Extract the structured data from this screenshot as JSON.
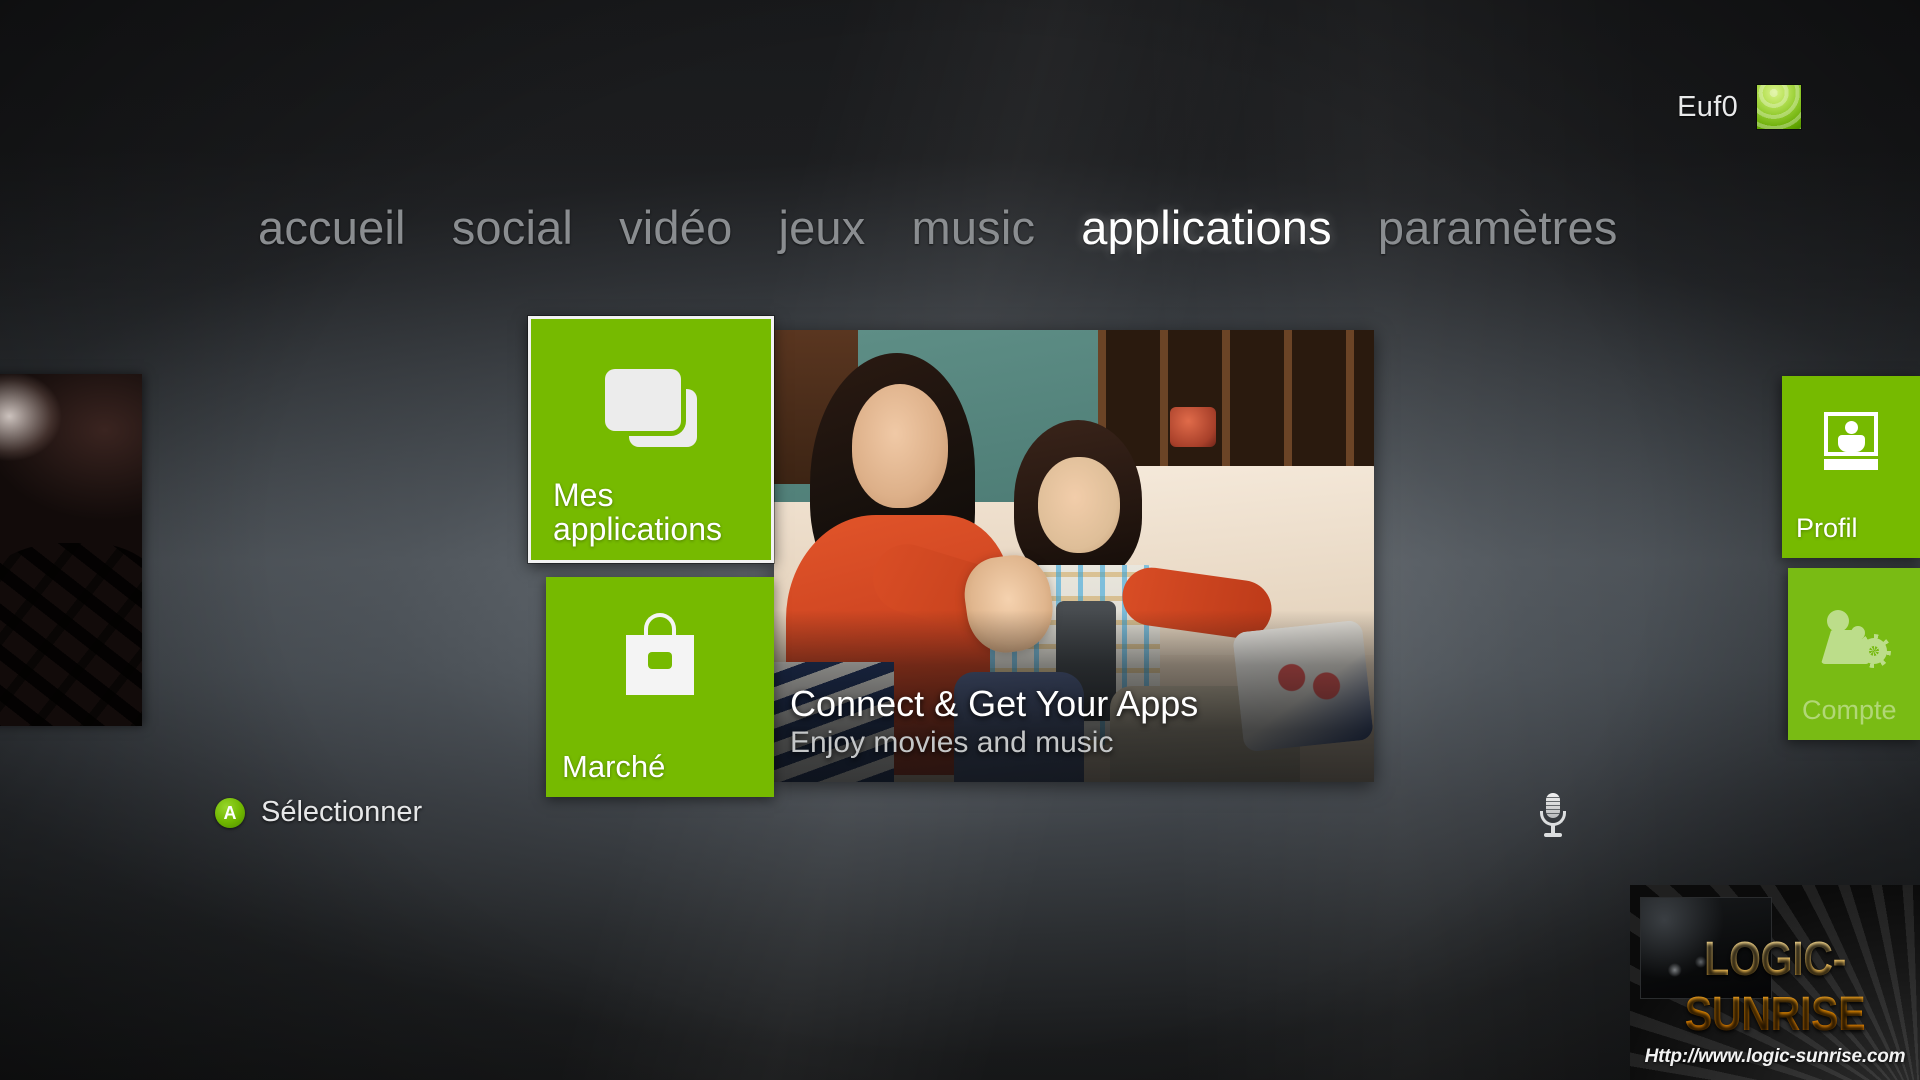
{
  "profile": {
    "gamertag": "Euf0",
    "gamerpic_name": "gamerpic"
  },
  "nav": {
    "items": [
      {
        "label": "accueil",
        "active": false
      },
      {
        "label": "social",
        "active": false
      },
      {
        "label": "vidéo",
        "active": false
      },
      {
        "label": "jeux",
        "active": false
      },
      {
        "label": "music",
        "active": false
      },
      {
        "label": "applications",
        "active": true
      },
      {
        "label": "paramètres",
        "active": false
      }
    ],
    "active_label": "applications"
  },
  "tiles": {
    "my_apps": {
      "label": "Mes\napplications",
      "label_line1": "Mes",
      "label_line2": "applications",
      "icon": "stacked-cards-icon",
      "selected": true
    },
    "marketplace": {
      "label": "Marché",
      "icon": "shopping-bag-icon",
      "selected": false
    }
  },
  "banner": {
    "title": "Connect & Get Your Apps",
    "subtitle": "Enjoy movies and music",
    "image_name": "family-watching-tv-photo"
  },
  "rail": {
    "profile_tile": {
      "label": "Profil",
      "icon": "profile-portrait-icon",
      "dimmed": false
    },
    "account_tile": {
      "label": "Compte",
      "icon": "family-settings-icon",
      "dimmed": true
    }
  },
  "peek": {
    "image_name": "previous-panel-photo"
  },
  "footer": {
    "button_glyph": "A",
    "action_label": "Sélectionner",
    "mic_icon": "microphone-icon"
  },
  "watermark": {
    "logo_text": "LOGIC-SUNRISE",
    "url_text": "Http://www.logic-sunrise.com"
  },
  "colors": {
    "accent_green": "#76BA00",
    "accent_green_dim": "#79BB14",
    "active_text": "#FFFFFF",
    "inactive_text": "#8A8D90",
    "watermark_orange": "#F39200"
  }
}
